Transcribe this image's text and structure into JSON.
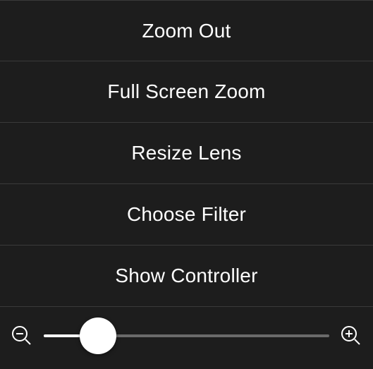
{
  "menu": {
    "items": [
      {
        "label": "Zoom Out"
      },
      {
        "label": "Full Screen Zoom"
      },
      {
        "label": "Resize Lens"
      },
      {
        "label": "Choose Filter"
      },
      {
        "label": "Show Controller"
      }
    ]
  },
  "slider": {
    "value_percent": 19,
    "minus_icon": "zoom-out-icon",
    "plus_icon": "zoom-in-icon"
  }
}
